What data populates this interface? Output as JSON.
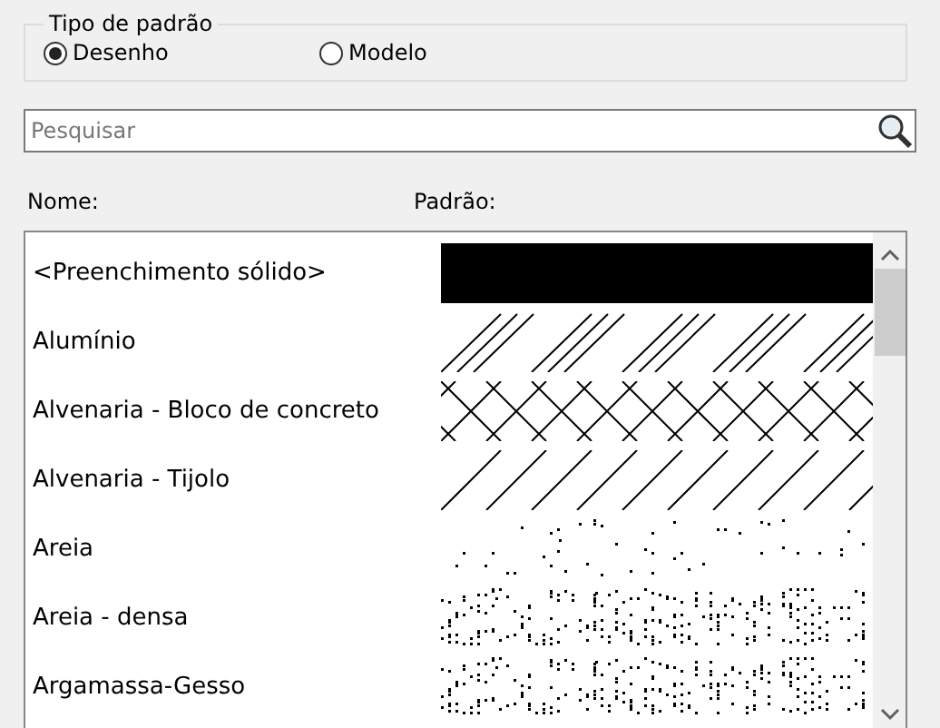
{
  "pattern_type": {
    "title": "Tipo de padrão",
    "options": [
      {
        "label": "Desenho",
        "selected": true
      },
      {
        "label": "Modelo",
        "selected": false
      }
    ]
  },
  "search": {
    "placeholder": "Pesquisar"
  },
  "columns": [
    "Nome:",
    "Padrão:"
  ],
  "rows": [
    {
      "name": "<Preenchimento sólido>",
      "kind": "solid"
    },
    {
      "name": "Alumínio",
      "kind": "hatch-groups"
    },
    {
      "name": "Alvenaria - Bloco de concreto",
      "kind": "crosshatch"
    },
    {
      "name": "Alvenaria - Tijolo",
      "kind": "diagonal"
    },
    {
      "name": "Areia",
      "kind": "sparse-dots"
    },
    {
      "name": "Areia - densa",
      "kind": "dense-dots"
    },
    {
      "name": "Argamassa-Gesso",
      "kind": "dense-dots"
    }
  ]
}
